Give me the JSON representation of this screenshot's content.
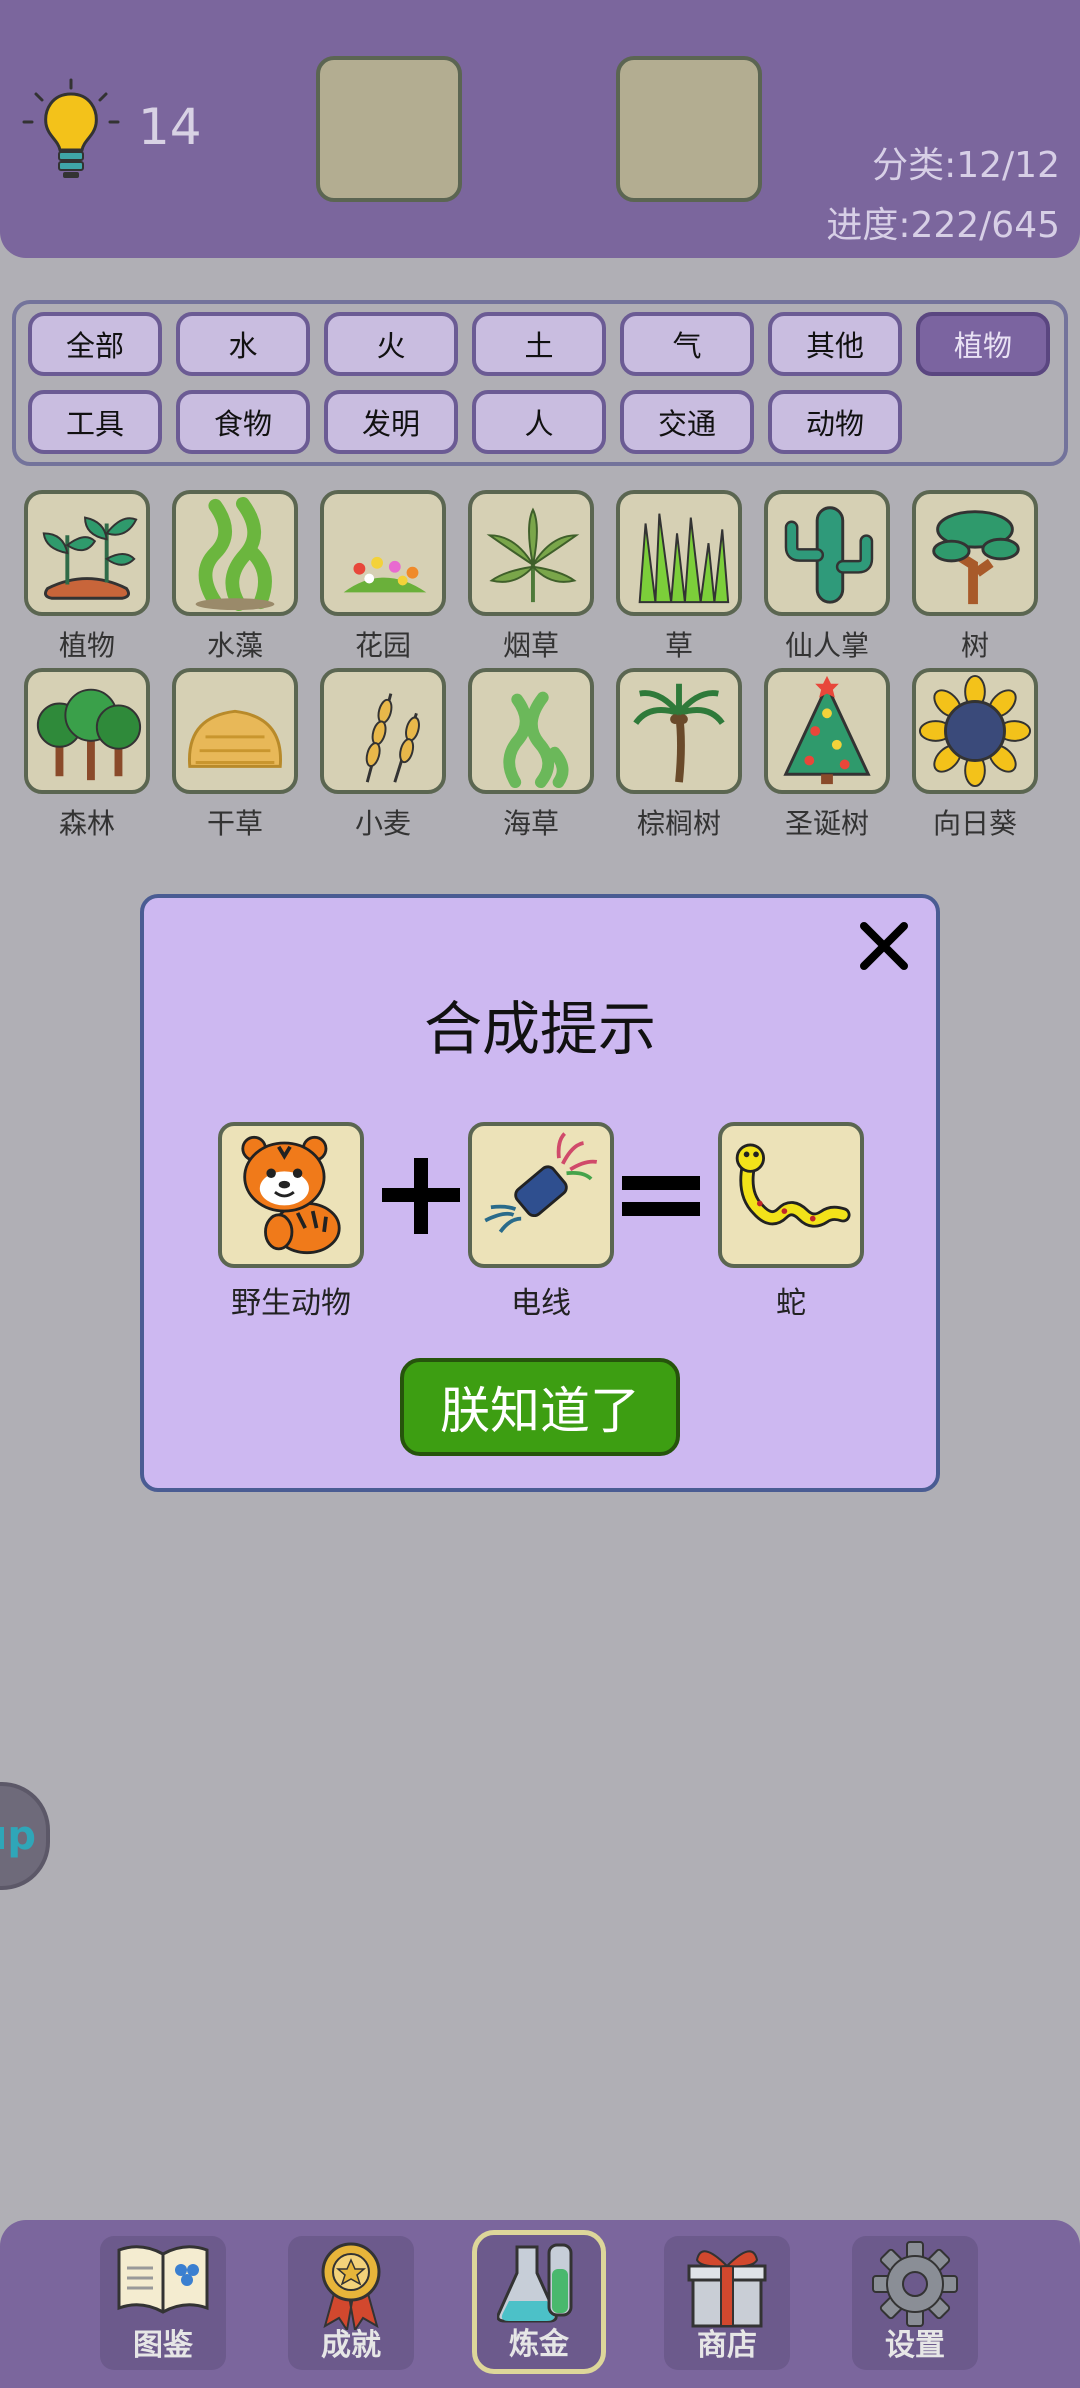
{
  "header": {
    "hint_count": "14",
    "category_stat": "分类:12/12",
    "progress_stat": "进度:222/645"
  },
  "categories": [
    {
      "label": "全部",
      "active": false
    },
    {
      "label": "水",
      "active": false
    },
    {
      "label": "火",
      "active": false
    },
    {
      "label": "土",
      "active": false
    },
    {
      "label": "气",
      "active": false
    },
    {
      "label": "其他",
      "active": false
    },
    {
      "label": "植物",
      "active": true
    },
    {
      "label": "工具",
      "active": false
    },
    {
      "label": "食物",
      "active": false
    },
    {
      "label": "发明",
      "active": false
    },
    {
      "label": "人",
      "active": false
    },
    {
      "label": "交通",
      "active": false
    },
    {
      "label": "动物",
      "active": false
    }
  ],
  "items": [
    {
      "label": "植物",
      "icon": "sprout-icon"
    },
    {
      "label": "水藻",
      "icon": "algae-icon"
    },
    {
      "label": "花园",
      "icon": "garden-icon"
    },
    {
      "label": "烟草",
      "icon": "tobacco-leaf-icon"
    },
    {
      "label": "草",
      "icon": "grass-icon"
    },
    {
      "label": "仙人掌",
      "icon": "cactus-icon"
    },
    {
      "label": "树",
      "icon": "tree-icon"
    },
    {
      "label": "森林",
      "icon": "forest-icon"
    },
    {
      "label": "干草",
      "icon": "hay-icon"
    },
    {
      "label": "小麦",
      "icon": "wheat-icon"
    },
    {
      "label": "海草",
      "icon": "seaweed-icon"
    },
    {
      "label": "棕榈树",
      "icon": "palm-tree-icon"
    },
    {
      "label": "圣诞树",
      "icon": "christmas-tree-icon"
    },
    {
      "label": "向日葵",
      "icon": "sunflower-icon"
    }
  ],
  "modal": {
    "title": "合成提示",
    "ingredient1": "野生动物",
    "ingredient2": "电线",
    "result": "蛇",
    "ok_label": "朕知道了"
  },
  "float_button": {
    "label": "up"
  },
  "nav": [
    {
      "label": "图鉴",
      "icon": "book-icon"
    },
    {
      "label": "成就",
      "icon": "medal-icon"
    },
    {
      "label": "炼金",
      "icon": "flask-icon",
      "active": true
    },
    {
      "label": "商店",
      "icon": "gift-icon"
    },
    {
      "label": "设置",
      "icon": "gear-icon"
    }
  ],
  "colors": {
    "header_bg": "#7b669d",
    "page_bg": "#b0afb5",
    "modal_bg": "#cdb8f1",
    "ok_button": "#3d9e12",
    "active_category": "#7b64a0"
  }
}
